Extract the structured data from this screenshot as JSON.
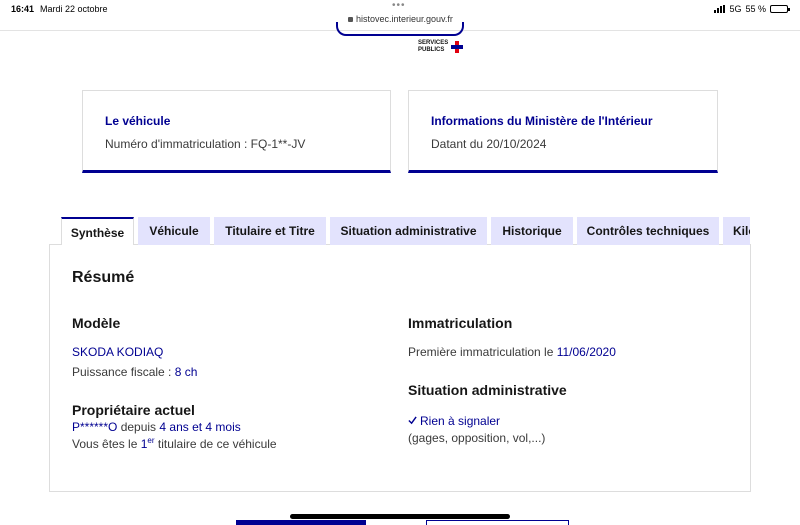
{
  "status_bar": {
    "time": "16:41",
    "date": "Mardi 22 octobre",
    "url": "histovec.interieur.gouv.fr",
    "network": "5G",
    "battery": "55 %",
    "battery_level": 0.55
  },
  "logo": {
    "line1": "SERVICES",
    "line2": "PUBLICS"
  },
  "vehicle_card": {
    "title": "Le véhicule",
    "text": "Numéro d'immatriculation : FQ-1**-JV"
  },
  "ministry_card": {
    "title": "Informations du Ministère de l'Intérieur",
    "text": "Datant du 20/10/2024"
  },
  "tabs": [
    {
      "label": "Synthèse"
    },
    {
      "label": "Véhicule"
    },
    {
      "label": "Titulaire et Titre"
    },
    {
      "label": "Situation administrative"
    },
    {
      "label": "Historique"
    },
    {
      "label": "Contrôles techniques"
    },
    {
      "label": "Kilo"
    }
  ],
  "summary": {
    "heading": "Résumé",
    "model": {
      "heading": "Modèle",
      "name": "SKODA KODIAQ",
      "power_label": "Puissance fiscale : ",
      "power_value": "8 ch"
    },
    "owner": {
      "heading": "Propriétaire actuel",
      "name": "P******O",
      "since_label": " depuis ",
      "since_value": "4 ans et 4 mois",
      "holder_prefix": "Vous êtes le ",
      "holder_rank": "1",
      "holder_rank_sup": "er",
      "holder_suffix": " titulaire de ce véhicule"
    },
    "registration": {
      "heading": "Immatriculation",
      "first_label": "Première immatriculation le ",
      "first_date": "11/06/2020"
    },
    "admin": {
      "heading": "Situation administrative",
      "status": "Rien à signaler",
      "details": "(gages, opposition, vol,...)"
    }
  },
  "colors": {
    "primary": "#000091",
    "tab_inactive": "#e3e3fd",
    "accent_red": "#e1000f"
  }
}
